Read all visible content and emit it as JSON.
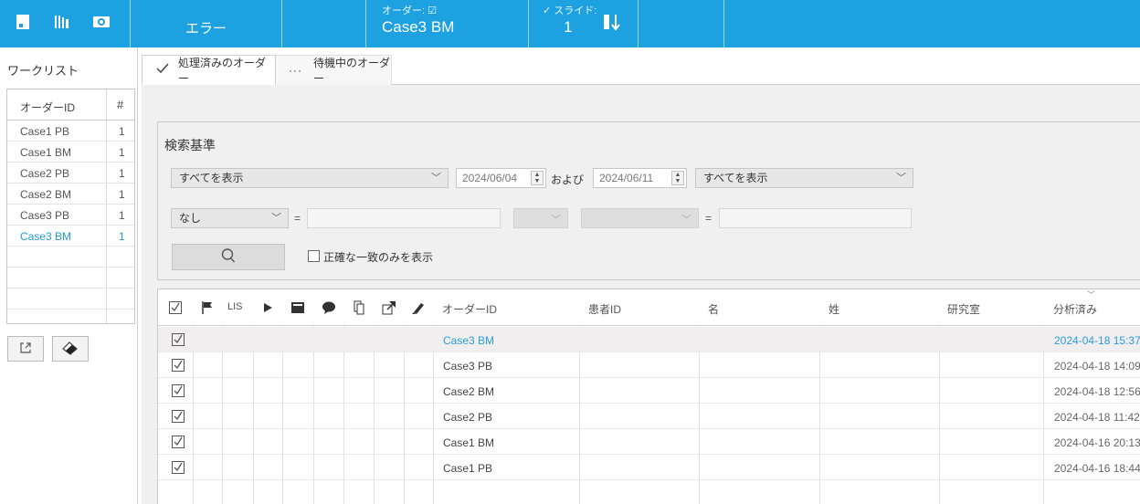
{
  "colors": {
    "topbar": "#1ea1e0",
    "accent": "#1e9ad6"
  },
  "topbar": {
    "icons": [
      "book-icon",
      "slides-icon",
      "eye-icon"
    ],
    "error_label": "エラー",
    "order_caption": "オーダー: ☑",
    "order_value": "Case3 BM",
    "slide_caption": "✓ スライド:",
    "slide_value": "1"
  },
  "worklist": {
    "title": "ワークリスト",
    "col_id": "オーダーID",
    "col_count": "#",
    "rows": [
      {
        "id": "Case1 PB",
        "count": "1"
      },
      {
        "id": "Case1 BM",
        "count": "1"
      },
      {
        "id": "Case2 PB",
        "count": "1"
      },
      {
        "id": "Case2 BM",
        "count": "1"
      },
      {
        "id": "Case3 PB",
        "count": "1"
      },
      {
        "id": "Case3 BM",
        "count": "1"
      }
    ],
    "buttons": [
      "export-icon",
      "eraser-icon"
    ]
  },
  "tabs": {
    "processed": "処理済みのオーダー",
    "waiting": "待機中のオーダー"
  },
  "search": {
    "title": "検索基準",
    "filter1": "すべてを表示",
    "date_from": "2024/06/04",
    "and_label": "および",
    "date_to": "2024/06/11",
    "filter2": "すべてを表示",
    "field": "なし",
    "eq1": "=",
    "eq2": "=",
    "exact_label": "正確な一致のみを表示"
  },
  "table": {
    "headers": {
      "lis": "LIS",
      "order_id": "オーダーID",
      "patient_id": "患者ID",
      "first_name": "名",
      "last_name": "姓",
      "lab": "研究室",
      "analyzed": "分析済み"
    },
    "rows": [
      {
        "order_id": "Case3 BM",
        "analyzed": "2024-04-18 15:37"
      },
      {
        "order_id": "Case3 PB",
        "analyzed": "2024-04-18 14:09"
      },
      {
        "order_id": "Case2 BM",
        "analyzed": "2024-04-18 12:56"
      },
      {
        "order_id": "Case2 PB",
        "analyzed": "2024-04-18 11:42"
      },
      {
        "order_id": "Case1 BM",
        "analyzed": "2024-04-16 20:13"
      },
      {
        "order_id": "Case1 PB",
        "analyzed": "2024-04-16 18:44"
      }
    ]
  }
}
